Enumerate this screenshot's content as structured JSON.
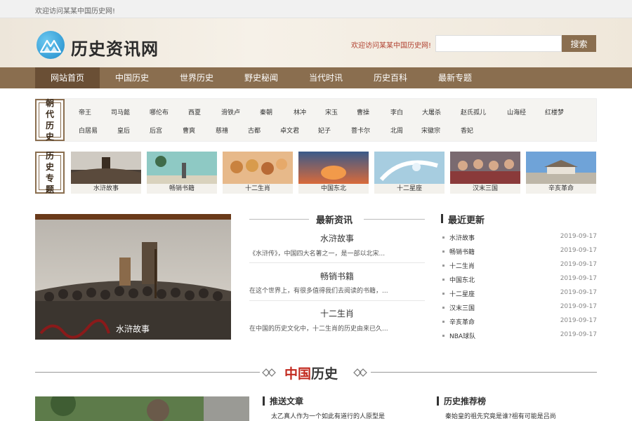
{
  "topbar": {
    "welcome": "欢迎访问某某中国历史网!"
  },
  "header": {
    "site_name": "历史资讯网",
    "logo_icon": "mountain-logo-icon",
    "welcome": "欢迎访问某某中国历史网!",
    "search_placeholder": "",
    "search_label": "搜索"
  },
  "colors": {
    "brand_brown": "#8a6e4f",
    "nav_active": "#6a4f35",
    "accent_red": "#c22a1f"
  },
  "nav": {
    "items": [
      {
        "label": "网站首页",
        "active": true
      },
      {
        "label": "中国历史"
      },
      {
        "label": "世界历史"
      },
      {
        "label": "野史秘闻"
      },
      {
        "label": "当代时讯"
      },
      {
        "label": "历史百科"
      },
      {
        "label": "最新专题"
      }
    ]
  },
  "dynasty": {
    "label": "朝代历史",
    "row1": [
      "帝王",
      "司马懿",
      "哪伦布",
      "西夏",
      "滑铁卢",
      "秦朝",
      "林冲",
      "宋玉",
      "曹操",
      "李白",
      "大屠杀",
      "赵氏孤儿",
      "山海经",
      "红楼梦"
    ],
    "row2": [
      "白居易",
      "皇后",
      "后宫",
      "曹爽",
      "慈禧",
      "古都",
      "卓文君",
      "妃子",
      "菩卡尔",
      "北周",
      "宋徽宗",
      "香妃"
    ]
  },
  "topics": {
    "label": "历史专题",
    "items": [
      {
        "caption": "水浒故事"
      },
      {
        "caption": "畅销书籍"
      },
      {
        "caption": "十二生肖"
      },
      {
        "caption": "中国东北"
      },
      {
        "caption": "十二星座"
      },
      {
        "caption": "汉末三国"
      },
      {
        "caption": "辛亥革命"
      }
    ]
  },
  "feature": {
    "caption": "水浒故事"
  },
  "latest_news": {
    "title": "最新资讯",
    "items": [
      {
        "title": "水浒故事",
        "desc": "《水浒传》，中国四大名著之一，是一部以北宋..."
      },
      {
        "title": "畅销书籍",
        "desc": "在这个世界上，有很多值得我们去阅读的书籍，..."
      },
      {
        "title": "十二生肖",
        "desc": "在中国的历史文化中，十二生肖的历史由来已久..."
      }
    ]
  },
  "recent_updates": {
    "title": "最近更新",
    "items": [
      {
        "title": "水浒故事",
        "date": "2019-09-17"
      },
      {
        "title": "畅销书籍",
        "date": "2019-09-17"
      },
      {
        "title": "十二生肖",
        "date": "2019-09-17"
      },
      {
        "title": "中国东北",
        "date": "2019-09-17"
      },
      {
        "title": "十二星座",
        "date": "2019-09-17"
      },
      {
        "title": "汉末三国",
        "date": "2019-09-17"
      },
      {
        "title": "辛亥革命",
        "date": "2019-09-17"
      },
      {
        "title": "NBA球队",
        "date": "2019-09-17"
      }
    ]
  },
  "china_section": {
    "title_red": "中国",
    "title_rest": "历史"
  },
  "bottom": {
    "recommend_title": "推送文章",
    "recommend_first": "太乙真人作为一个如此有道行的人原型是",
    "ranking_title": "历史推荐榜",
    "ranking_first": "秦始皇的祖先究竟是谁?祖有可能是吕尚"
  }
}
